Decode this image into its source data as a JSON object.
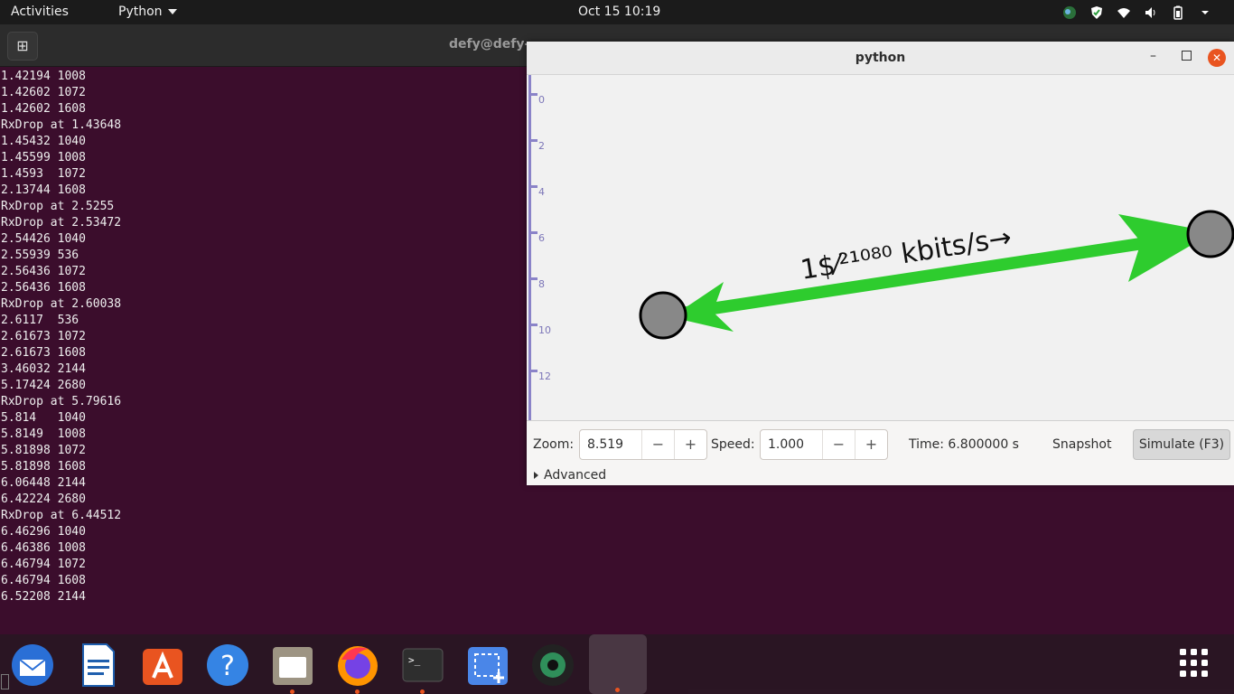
{
  "topbar": {
    "activities": "Activities",
    "app_menu": "Python",
    "clock": "Oct 15  10:19"
  },
  "terminal": {
    "title": "defy@defy-",
    "lines": [
      "1.42194 1008",
      "1.42602 1072",
      "1.42602 1608",
      "RxDrop at 1.43648",
      "1.45432 1040",
      "1.45599 1008",
      "1.4593  1072",
      "2.13744 1608",
      "RxDrop at 2.5255",
      "RxDrop at 2.53472",
      "2.54426 1040",
      "2.55939 536",
      "2.56436 1072",
      "2.56436 1608",
      "RxDrop at 2.60038",
      "2.6117  536",
      "2.61673 1072",
      "2.61673 1608",
      "3.46032 2144",
      "5.17424 2680",
      "RxDrop at 5.79616",
      "5.814   1040",
      "5.8149  1008",
      "5.81898 1072",
      "5.81898 1608",
      "6.06448 2144",
      "6.42224 2680",
      "RxDrop at 6.44512",
      "6.46296 1040",
      "6.46386 1008",
      "6.46794 1072",
      "6.46794 1608",
      "6.52208 2144"
    ]
  },
  "pywindow": {
    "title": "python",
    "ruler_ticks": [
      "0",
      "2",
      "4",
      "6",
      "8",
      "10",
      "12"
    ],
    "link_label": "1$⁄²¹⁰⁸⁰ kbits/s→",
    "controls": {
      "zoom_label": "Zoom:",
      "zoom_value": "8.519",
      "speed_label": "Speed:",
      "speed_value": "1.000",
      "time_text": "Time: 6.800000 s",
      "snapshot": "Snapshot",
      "simulate": "Simulate (F3)",
      "advanced": "Advanced",
      "minus": "−",
      "plus": "+"
    }
  },
  "colors": {
    "terminal_bg": "#3b0d2c",
    "link_green": "#2ecc2e",
    "node_fill": "#888888",
    "close_button": "#e95420"
  },
  "dock": {
    "apps": [
      "thunderbird-icon",
      "writer-icon",
      "app-center-icon",
      "help-icon",
      "files-icon",
      "firefox-icon",
      "terminal-icon",
      "screenshot-icon",
      "camera-icon",
      "python-app-icon"
    ]
  }
}
